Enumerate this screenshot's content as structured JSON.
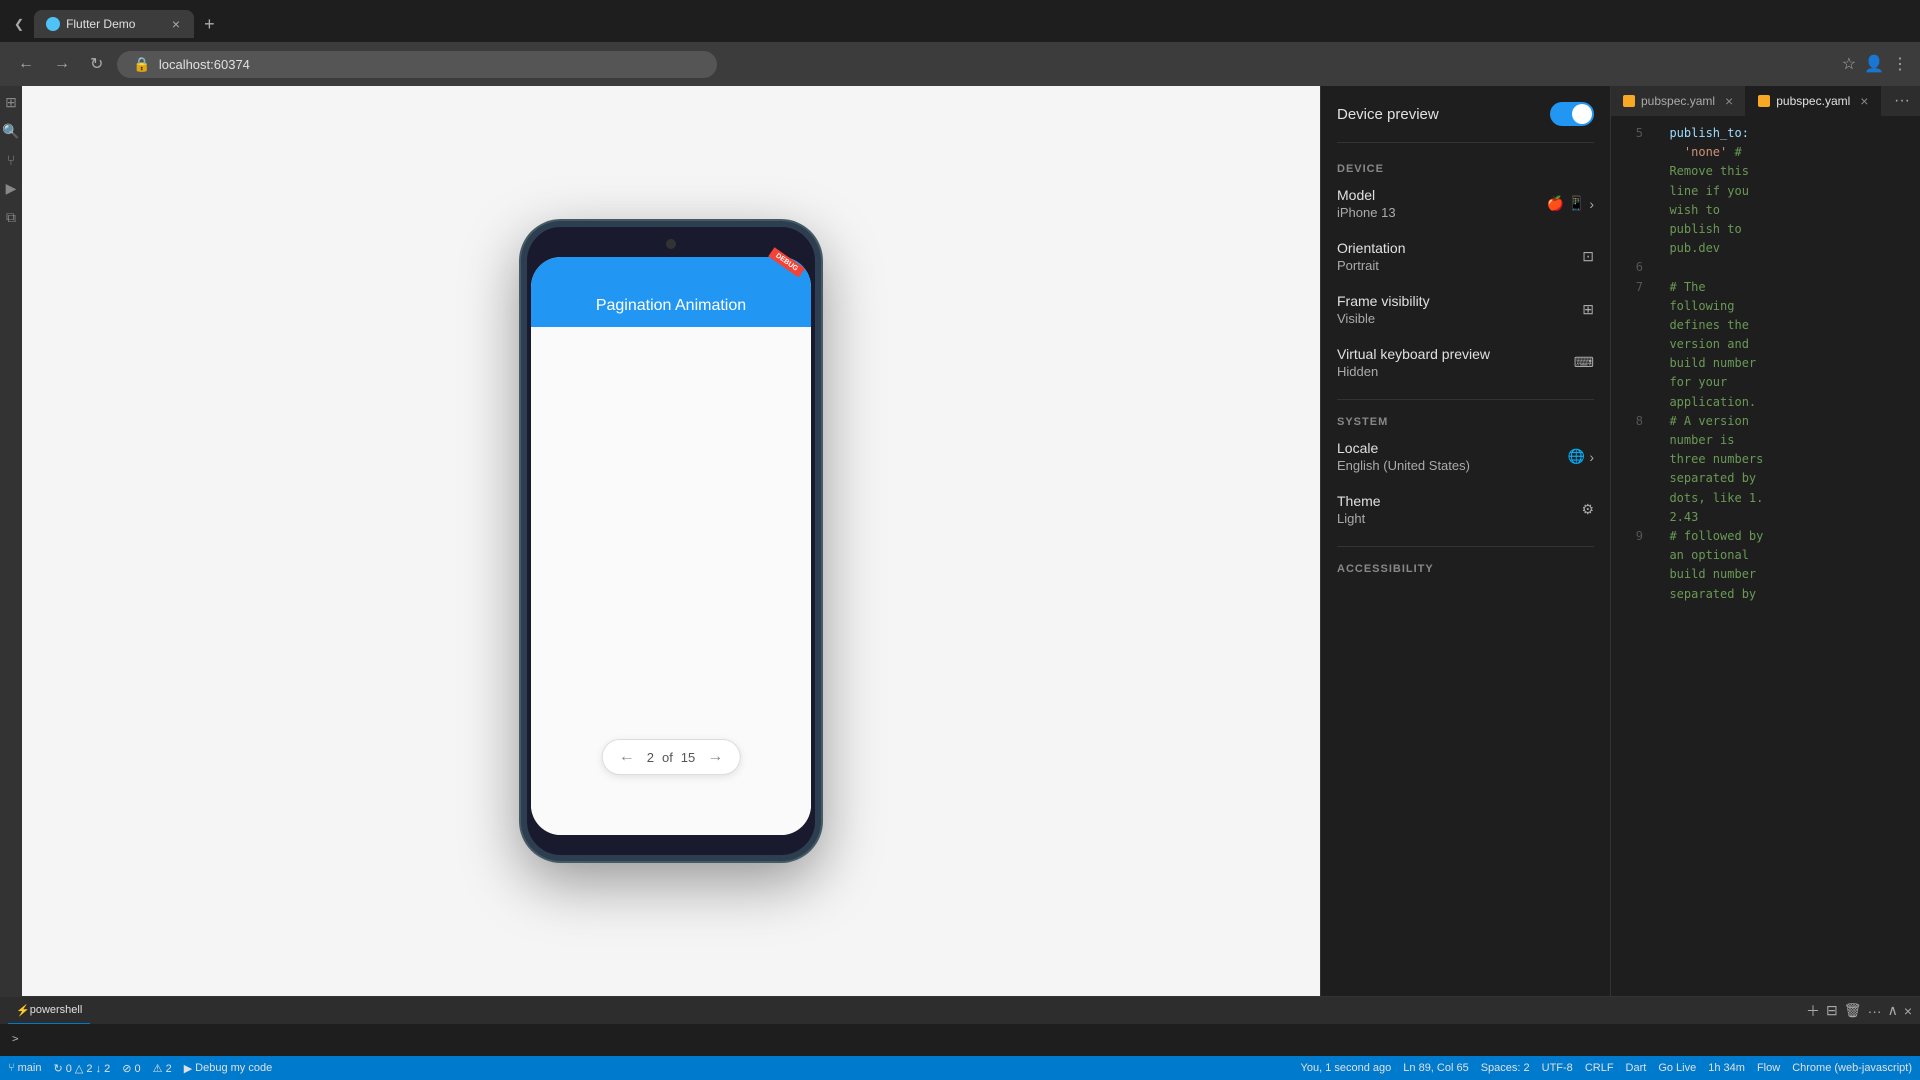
{
  "browser": {
    "tab_favicon": "flutter-icon",
    "tab_title": "Flutter Demo",
    "tab_close": "×",
    "tab_add": "+",
    "address": "localhost:60374",
    "nav": {
      "back": "←",
      "forward": "→",
      "refresh": "↻",
      "bookmark": "☆",
      "profile": "👤",
      "menu": "⋮"
    }
  },
  "flutter_app": {
    "title": "Pagination Animation",
    "debug_label": "DEBUG",
    "pagination": {
      "prev": "←",
      "current": "2",
      "separator": "of",
      "total": "15",
      "next": "→"
    }
  },
  "device_panel": {
    "device_preview_label": "Device preview",
    "toggle_state": "on",
    "sections": {
      "device": "DEVICE",
      "system": "SYSTEM",
      "accessibility": "ACCESSIBILITY"
    },
    "settings": [
      {
        "label": "Model",
        "value": "iPhone 13",
        "icon": "🍎",
        "icon2": "📱",
        "chevron": "›"
      },
      {
        "label": "Orientation",
        "value": "Portrait",
        "icon": "⊡"
      },
      {
        "label": "Frame visibility",
        "value": "Visible",
        "icon": "⊞"
      },
      {
        "label": "Virtual keyboard preview",
        "value": "Hidden",
        "icon": "⌨"
      },
      {
        "label": "Locale",
        "value": "English (United States)",
        "icon": "🌐",
        "chevron": "›"
      },
      {
        "label": "Theme",
        "value": "Light",
        "icon": "⚙"
      }
    ]
  },
  "editor": {
    "tabs": [
      {
        "name": "pubspec.yaml",
        "active": true
      },
      {
        "name": "pubspec.yaml",
        "active": false
      }
    ],
    "code_lines": [
      {
        "num": "5",
        "content": "  publish_to:",
        "type": "key"
      },
      {
        "num": "",
        "content": "    'none' #",
        "type": "value"
      },
      {
        "num": "",
        "content": "  Remove this",
        "type": "comment"
      },
      {
        "num": "",
        "content": "  line if you",
        "type": "comment"
      },
      {
        "num": "",
        "content": "  wish to",
        "type": "comment"
      },
      {
        "num": "",
        "content": "  publish to",
        "type": "comment"
      },
      {
        "num": "",
        "content": "  pub.dev",
        "type": "comment"
      },
      {
        "num": "6",
        "content": "",
        "type": "empty"
      },
      {
        "num": "7",
        "content": "  # The",
        "type": "comment"
      },
      {
        "num": "",
        "content": "  following",
        "type": "comment"
      },
      {
        "num": "",
        "content": "  defines the",
        "type": "comment"
      },
      {
        "num": "",
        "content": "  version and",
        "type": "comment"
      },
      {
        "num": "",
        "content": "  build number",
        "type": "comment"
      },
      {
        "num": "",
        "content": "  for your",
        "type": "comment"
      },
      {
        "num": "",
        "content": "  application.",
        "type": "comment"
      },
      {
        "num": "8",
        "content": "  # A version",
        "type": "comment"
      },
      {
        "num": "",
        "content": "  number is",
        "type": "comment"
      },
      {
        "num": "",
        "content": "  three numbers",
        "type": "comment"
      },
      {
        "num": "",
        "content": "  separated by",
        "type": "comment"
      },
      {
        "num": "",
        "content": "  dots, like 1.",
        "type": "comment"
      },
      {
        "num": "",
        "content": "  2.43",
        "type": "comment"
      },
      {
        "num": "9",
        "content": "  # followed by",
        "type": "comment"
      },
      {
        "num": "",
        "content": "  an optional",
        "type": "comment"
      },
      {
        "num": "",
        "content": "  build number",
        "type": "comment"
      },
      {
        "num": "",
        "content": "  separated by",
        "type": "comment"
      }
    ]
  },
  "status_bar": {
    "branch": "main",
    "sync": "↻ 0 △ 2 ↓ 2",
    "errors": "⊘ 0",
    "warnings": "⚠ 2",
    "debug": "Debug my code",
    "location": "You, 1 second ago",
    "cursor": "Ln 89, Col 65",
    "spaces": "Spaces: 2",
    "encoding": "UTF-8",
    "line_ending": "CRLF",
    "language": "Dart",
    "go_live": "Go Live",
    "time": "1h 34m",
    "flow": "Flow",
    "chrome": "Chrome (web-javascript)"
  },
  "bottom_panel": {
    "active_tab": "powershell",
    "tabs": [
      "powershell"
    ]
  }
}
